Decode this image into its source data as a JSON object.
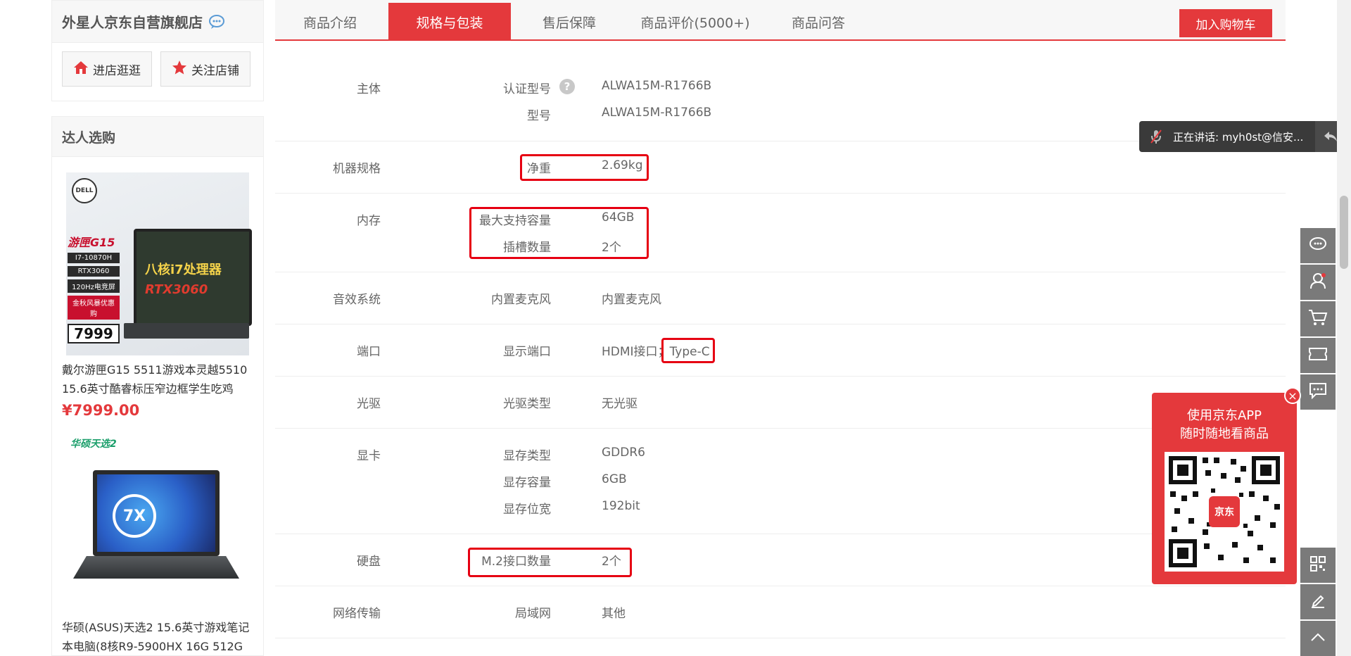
{
  "shop": {
    "name": "外星人京东自营旗舰店",
    "enter_label": "进店逛逛",
    "follow_label": "关注店铺"
  },
  "talent": {
    "title": "达人选购",
    "products": [
      {
        "title": "戴尔游匣G15 5511游戏本灵越5510 15.6英寸酷睿标压窄边框学生吃鸡",
        "price": "¥7999.00",
        "image_text": {
          "brand": "DELL",
          "series": "游匣G15",
          "specs": [
            "I7-10870H",
            "RTX3060",
            "120Hz电竞屏",
            "金秋风暴优惠购"
          ],
          "promo_price": "7999",
          "screen_line1": "八核i7处理器",
          "screen_line2": "RTX3060"
        }
      },
      {
        "title": "华硕(ASUS)天选2 15.6英寸游戏笔记本电脑(8核R9-5900HX 16G 512G",
        "brand_logo": "华硕天选2",
        "screen_logo": "7X"
      }
    ]
  },
  "tabs": [
    {
      "label": "商品介绍",
      "active": false
    },
    {
      "label": "规格与包装",
      "active": true
    },
    {
      "label": "售后保障",
      "active": false
    },
    {
      "label": "商品评价(5000+)",
      "active": false
    },
    {
      "label": "商品问答",
      "active": false
    }
  ],
  "cart_label": "加入购物车",
  "specs": [
    {
      "group": "主体",
      "rows": [
        {
          "key": "认证型号",
          "value": "ALWA15M-R1766B",
          "help": true
        },
        {
          "key": "型号",
          "value": "ALWA15M-R1766B"
        }
      ]
    },
    {
      "group": "机器规格",
      "rows": [
        {
          "key": "净重",
          "value": "2.69kg"
        }
      ]
    },
    {
      "group": "内存",
      "rows": [
        {
          "key": "最大支持容量",
          "value": "64GB"
        },
        {
          "key": "插槽数量",
          "value": "2个"
        }
      ]
    },
    {
      "group": "音效系统",
      "rows": [
        {
          "key": "内置麦克风",
          "value": "内置麦克风"
        }
      ]
    },
    {
      "group": "端口",
      "rows": [
        {
          "key": "显示端口",
          "value_prefix": "HDMI接口；",
          "value_highlight": "Type-C"
        }
      ]
    },
    {
      "group": "光驱",
      "rows": [
        {
          "key": "光驱类型",
          "value": "无光驱"
        }
      ]
    },
    {
      "group": "显卡",
      "rows": [
        {
          "key": "显存类型",
          "value": "GDDR6"
        },
        {
          "key": "显存容量",
          "value": "6GB"
        },
        {
          "key": "显存位宽",
          "value": "192bit"
        }
      ]
    },
    {
      "group": "硬盘",
      "rows": [
        {
          "key": "M.2接口数量",
          "value": "2个"
        }
      ]
    },
    {
      "group": "网络传输",
      "rows": [
        {
          "key": "局域网",
          "value": "其他"
        }
      ]
    }
  ],
  "help_symbol": "?",
  "voice": {
    "text": "正在讲话: myh0st@信安..."
  },
  "qr": {
    "line1": "使用京东APP",
    "line2": "随时随地看商品",
    "center_label": "京东",
    "close_symbol": "×"
  },
  "colors": {
    "accent": "#e4393c",
    "highlight_box": "#e60012",
    "sidebar_button": "#7a7a7a",
    "tuf_green": "#1a9e6a"
  }
}
